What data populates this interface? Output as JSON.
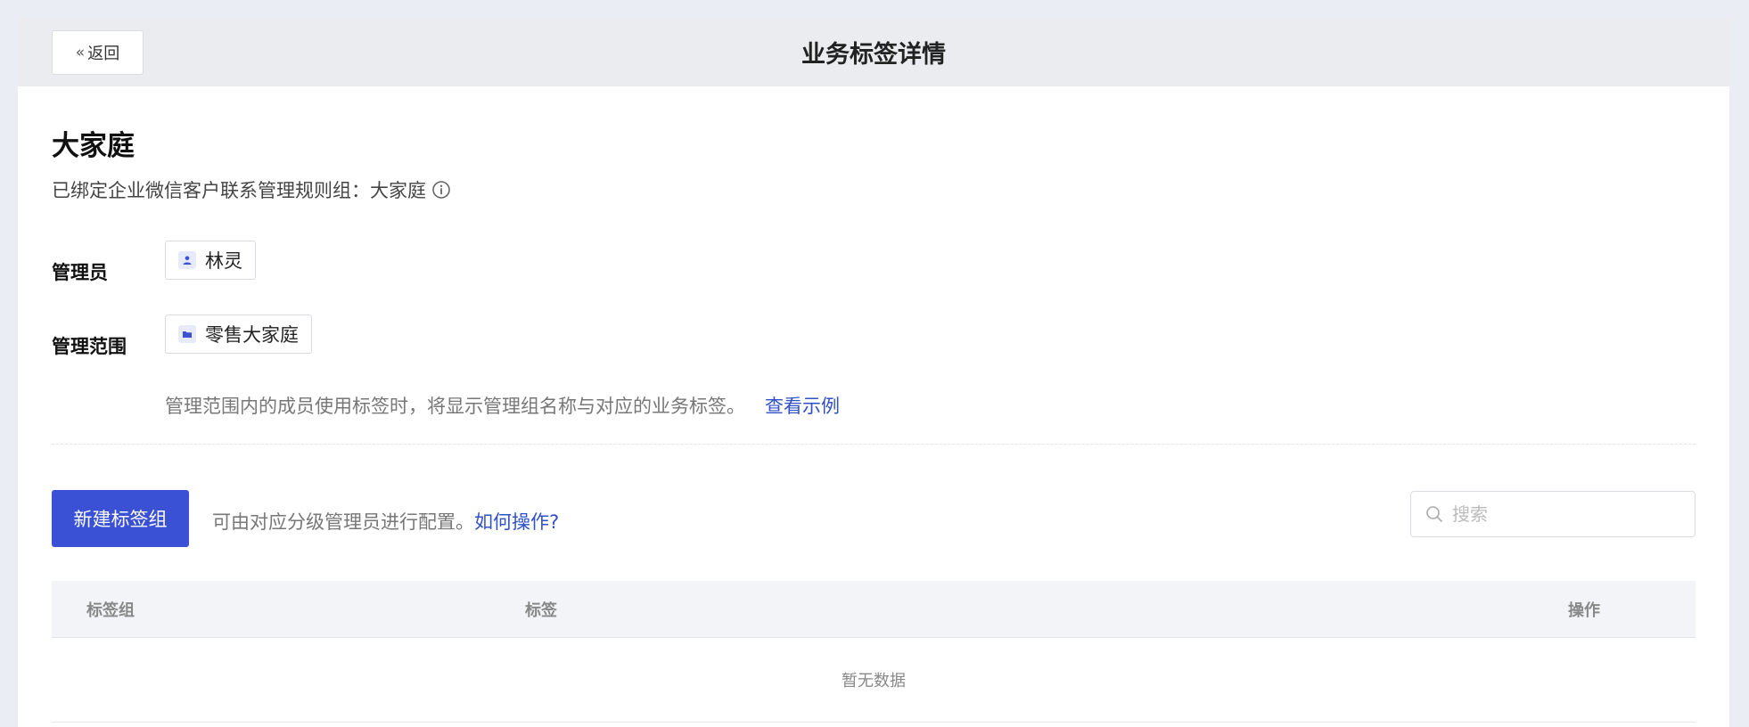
{
  "header": {
    "back_label": "返回",
    "title": "业务标签详情"
  },
  "business": {
    "name": "大家庭",
    "bind_info": "已绑定企业微信客户联系管理规则组：大家庭"
  },
  "admin": {
    "label": "管理员",
    "name": "林灵"
  },
  "scope": {
    "label": "管理范围",
    "name": "零售大家庭",
    "description": "管理范围内的成员使用标签时，将显示管理组名称与对应的业务标签。",
    "example_link": "查看示例"
  },
  "toolbar": {
    "new_group_label": "新建标签组",
    "hint": "可由对应分级管理员进行配置。",
    "how_link": "如何操作?",
    "search_placeholder": "搜索"
  },
  "table": {
    "columns": [
      "标签组",
      "标签",
      "操作"
    ],
    "empty_text": "暂无数据"
  },
  "colors": {
    "accent": "#3a51d6",
    "link": "#3050c8",
    "page_bg": "#eaedf4"
  }
}
